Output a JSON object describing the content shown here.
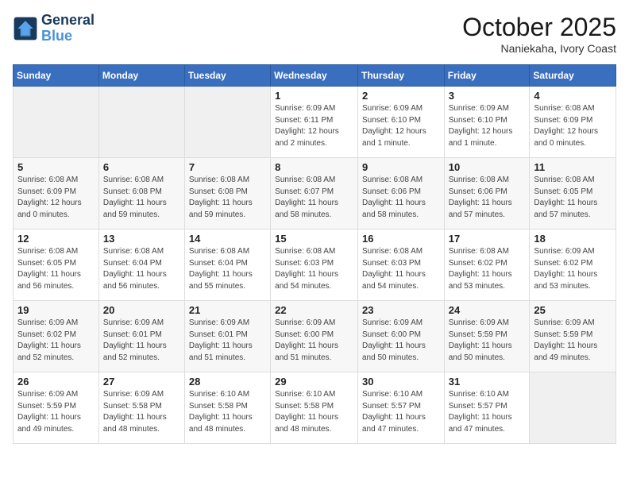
{
  "header": {
    "logo_line1": "General",
    "logo_line2": "Blue",
    "month": "October 2025",
    "location": "Naniekaha, Ivory Coast"
  },
  "weekdays": [
    "Sunday",
    "Monday",
    "Tuesday",
    "Wednesday",
    "Thursday",
    "Friday",
    "Saturday"
  ],
  "weeks": [
    [
      {
        "day": "",
        "info": ""
      },
      {
        "day": "",
        "info": ""
      },
      {
        "day": "",
        "info": ""
      },
      {
        "day": "1",
        "info": "Sunrise: 6:09 AM\nSunset: 6:11 PM\nDaylight: 12 hours\nand 2 minutes."
      },
      {
        "day": "2",
        "info": "Sunrise: 6:09 AM\nSunset: 6:10 PM\nDaylight: 12 hours\nand 1 minute."
      },
      {
        "day": "3",
        "info": "Sunrise: 6:09 AM\nSunset: 6:10 PM\nDaylight: 12 hours\nand 1 minute."
      },
      {
        "day": "4",
        "info": "Sunrise: 6:08 AM\nSunset: 6:09 PM\nDaylight: 12 hours\nand 0 minutes."
      }
    ],
    [
      {
        "day": "5",
        "info": "Sunrise: 6:08 AM\nSunset: 6:09 PM\nDaylight: 12 hours\nand 0 minutes."
      },
      {
        "day": "6",
        "info": "Sunrise: 6:08 AM\nSunset: 6:08 PM\nDaylight: 11 hours\nand 59 minutes."
      },
      {
        "day": "7",
        "info": "Sunrise: 6:08 AM\nSunset: 6:08 PM\nDaylight: 11 hours\nand 59 minutes."
      },
      {
        "day": "8",
        "info": "Sunrise: 6:08 AM\nSunset: 6:07 PM\nDaylight: 11 hours\nand 58 minutes."
      },
      {
        "day": "9",
        "info": "Sunrise: 6:08 AM\nSunset: 6:06 PM\nDaylight: 11 hours\nand 58 minutes."
      },
      {
        "day": "10",
        "info": "Sunrise: 6:08 AM\nSunset: 6:06 PM\nDaylight: 11 hours\nand 57 minutes."
      },
      {
        "day": "11",
        "info": "Sunrise: 6:08 AM\nSunset: 6:05 PM\nDaylight: 11 hours\nand 57 minutes."
      }
    ],
    [
      {
        "day": "12",
        "info": "Sunrise: 6:08 AM\nSunset: 6:05 PM\nDaylight: 11 hours\nand 56 minutes."
      },
      {
        "day": "13",
        "info": "Sunrise: 6:08 AM\nSunset: 6:04 PM\nDaylight: 11 hours\nand 56 minutes."
      },
      {
        "day": "14",
        "info": "Sunrise: 6:08 AM\nSunset: 6:04 PM\nDaylight: 11 hours\nand 55 minutes."
      },
      {
        "day": "15",
        "info": "Sunrise: 6:08 AM\nSunset: 6:03 PM\nDaylight: 11 hours\nand 54 minutes."
      },
      {
        "day": "16",
        "info": "Sunrise: 6:08 AM\nSunset: 6:03 PM\nDaylight: 11 hours\nand 54 minutes."
      },
      {
        "day": "17",
        "info": "Sunrise: 6:08 AM\nSunset: 6:02 PM\nDaylight: 11 hours\nand 53 minutes."
      },
      {
        "day": "18",
        "info": "Sunrise: 6:09 AM\nSunset: 6:02 PM\nDaylight: 11 hours\nand 53 minutes."
      }
    ],
    [
      {
        "day": "19",
        "info": "Sunrise: 6:09 AM\nSunset: 6:02 PM\nDaylight: 11 hours\nand 52 minutes."
      },
      {
        "day": "20",
        "info": "Sunrise: 6:09 AM\nSunset: 6:01 PM\nDaylight: 11 hours\nand 52 minutes."
      },
      {
        "day": "21",
        "info": "Sunrise: 6:09 AM\nSunset: 6:01 PM\nDaylight: 11 hours\nand 51 minutes."
      },
      {
        "day": "22",
        "info": "Sunrise: 6:09 AM\nSunset: 6:00 PM\nDaylight: 11 hours\nand 51 minutes."
      },
      {
        "day": "23",
        "info": "Sunrise: 6:09 AM\nSunset: 6:00 PM\nDaylight: 11 hours\nand 50 minutes."
      },
      {
        "day": "24",
        "info": "Sunrise: 6:09 AM\nSunset: 5:59 PM\nDaylight: 11 hours\nand 50 minutes."
      },
      {
        "day": "25",
        "info": "Sunrise: 6:09 AM\nSunset: 5:59 PM\nDaylight: 11 hours\nand 49 minutes."
      }
    ],
    [
      {
        "day": "26",
        "info": "Sunrise: 6:09 AM\nSunset: 5:59 PM\nDaylight: 11 hours\nand 49 minutes."
      },
      {
        "day": "27",
        "info": "Sunrise: 6:09 AM\nSunset: 5:58 PM\nDaylight: 11 hours\nand 48 minutes."
      },
      {
        "day": "28",
        "info": "Sunrise: 6:10 AM\nSunset: 5:58 PM\nDaylight: 11 hours\nand 48 minutes."
      },
      {
        "day": "29",
        "info": "Sunrise: 6:10 AM\nSunset: 5:58 PM\nDaylight: 11 hours\nand 48 minutes."
      },
      {
        "day": "30",
        "info": "Sunrise: 6:10 AM\nSunset: 5:57 PM\nDaylight: 11 hours\nand 47 minutes."
      },
      {
        "day": "31",
        "info": "Sunrise: 6:10 AM\nSunset: 5:57 PM\nDaylight: 11 hours\nand 47 minutes."
      },
      {
        "day": "",
        "info": ""
      }
    ]
  ]
}
